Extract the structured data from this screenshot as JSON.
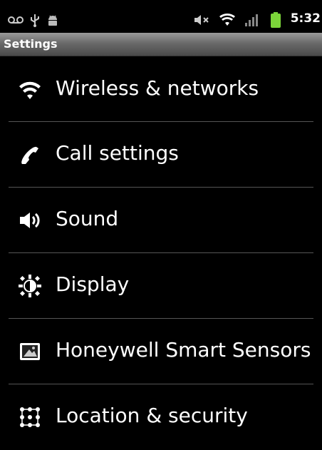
{
  "status_bar": {
    "time": "5:32",
    "icons": [
      "voicemail-icon",
      "usb-icon",
      "android-debug-icon",
      "mute-icon",
      "wifi-icon",
      "signal-icon",
      "battery-icon"
    ]
  },
  "header": {
    "title": "Settings"
  },
  "settings": {
    "items": [
      {
        "label": "Wireless & networks",
        "icon": "wifi-icon"
      },
      {
        "label": "Call settings",
        "icon": "phone-icon"
      },
      {
        "label": "Sound",
        "icon": "speaker-icon"
      },
      {
        "label": "Display",
        "icon": "brightness-icon"
      },
      {
        "label": "Honeywell Smart Sensors",
        "icon": "sensor-icon"
      },
      {
        "label": "Location & security",
        "icon": "grid-lock-icon"
      }
    ]
  },
  "colors": {
    "background": "#000000",
    "title_bar": "#6a6a6a",
    "battery": "#7cd43a",
    "text": "#ffffff"
  }
}
